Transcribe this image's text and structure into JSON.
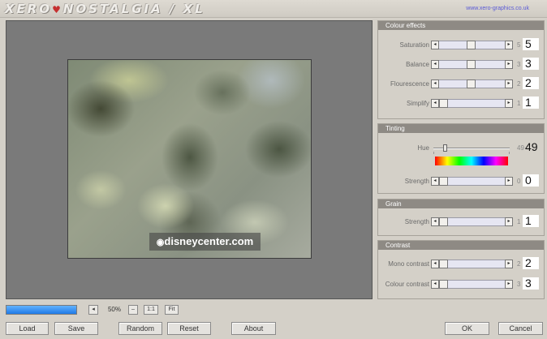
{
  "app": {
    "title_left": "XERO",
    "title_mark": "♥",
    "title_right": "NOSTALGIA / XL",
    "url": "www.xero-graphics.co.uk"
  },
  "preview": {
    "watermark_mark": "◉",
    "watermark_text": "disneycenter.com"
  },
  "zoom": {
    "progress_fraction": 1.0,
    "value": "50%",
    "fit_ratio_label": "1:1",
    "fit_label": "Fit"
  },
  "colour_effects": {
    "title": "Colour effects",
    "rows": [
      {
        "label": "Saturation",
        "small": "5",
        "value": "5",
        "position": 0.5
      },
      {
        "label": "Balance",
        "small": "3",
        "value": "3",
        "position": 0.5
      },
      {
        "label": "Flourescence",
        "small": "2",
        "value": "2",
        "position": 0.5
      },
      {
        "label": "Simplify",
        "small": "1",
        "value": "1",
        "position": 0.0
      }
    ]
  },
  "tinting": {
    "title": "Tinting",
    "hue": {
      "label": "Hue",
      "small": "49",
      "value": "49",
      "position": 0.13
    },
    "strength": {
      "label": "Strength",
      "small": "0",
      "value": "0",
      "position": 0.0
    }
  },
  "grain": {
    "title": "Grain",
    "strength": {
      "label": "Strength",
      "small": "1",
      "value": "1",
      "position": 0.0
    }
  },
  "contrast": {
    "title": "Contrast",
    "mono": {
      "label": "Mono contrast",
      "small": "2",
      "value": "2",
      "position": 0.0
    },
    "colour": {
      "label": "Colour contrast",
      "small": "3",
      "value": "3",
      "position": 0.0
    }
  },
  "buttons": {
    "load": "Load",
    "save": "Save",
    "random": "Random",
    "reset": "Reset",
    "about": "About",
    "ok": "OK",
    "cancel": "Cancel"
  },
  "icons": {
    "left": "◂",
    "right": "▸",
    "minus": "–"
  },
  "colors": {
    "section_header": "#8e8a84",
    "slider_track": "#e6e6f2",
    "progress": "#1e7ae6",
    "url": "#5a5ad6"
  }
}
